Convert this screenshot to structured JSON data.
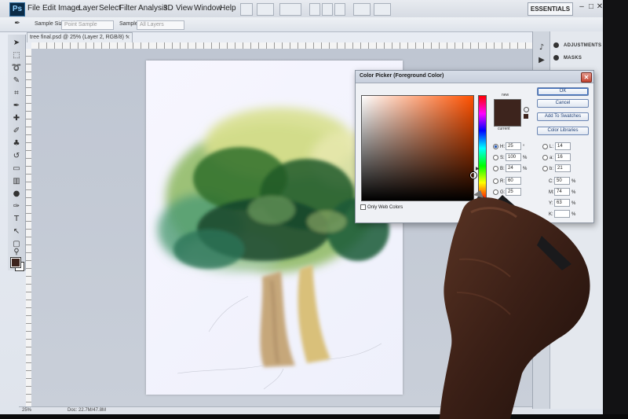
{
  "app": {
    "logo": "Ps"
  },
  "menu": [
    "File",
    "Edit",
    "Image",
    "Layer",
    "Select",
    "Filter",
    "Analysis",
    "3D",
    "View",
    "Window",
    "Help"
  ],
  "workspace": "ESSENTIALS",
  "window_controls": [
    "–",
    "□",
    "✕"
  ],
  "options": {
    "sample_size_label": "Sample Size:",
    "sample_size_value": "Point Sample",
    "sample_label": "Sample:",
    "sample_value": "All Layers"
  },
  "document": {
    "tab_title": "tree final.psd @ 25% (Layer 2, RGB/8) *",
    "zoom": "25%",
    "doc_info": "Doc: 22.7M/47.8M"
  },
  "panels": [
    "ADJUSTMENTS",
    "MASKS"
  ],
  "color_picker": {
    "title": "Color Picker (Foreground Color)",
    "close": "✕",
    "new_label": "new",
    "current_label": "current",
    "buttons": {
      "ok": "OK",
      "cancel": "Cancel",
      "add": "Add To Swatches",
      "libraries": "Color Libraries"
    },
    "hsb": [
      {
        "label": "H:",
        "value": "25",
        "unit": "°"
      },
      {
        "label": "S:",
        "value": "100",
        "unit": "%"
      },
      {
        "label": "B:",
        "value": "24",
        "unit": "%"
      }
    ],
    "rgb": [
      {
        "label": "R:",
        "value": "60"
      },
      {
        "label": "G:",
        "value": "25"
      }
    ],
    "lab": [
      {
        "label": "L:",
        "value": "14"
      },
      {
        "label": "a:",
        "value": "16"
      },
      {
        "label": "b:",
        "value": "21"
      }
    ],
    "cmyk": [
      {
        "label": "C:",
        "value": "50",
        "unit": "%"
      },
      {
        "label": "M:",
        "value": "74",
        "unit": "%"
      },
      {
        "label": "Y:",
        "value": "63",
        "unit": "%"
      },
      {
        "label": "K:",
        "value": "",
        "unit": "%"
      }
    ],
    "only_web_colors": "Only Web Colors",
    "selected_color": "#3d241d"
  }
}
